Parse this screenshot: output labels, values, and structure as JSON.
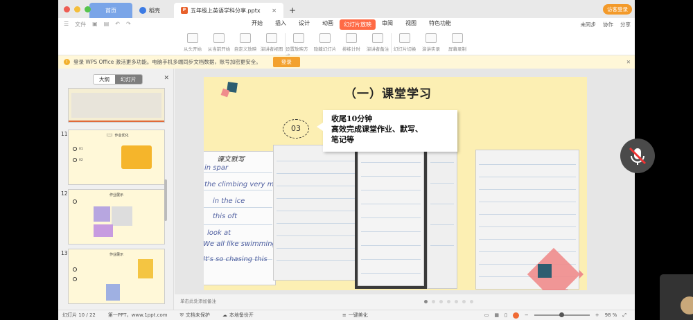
{
  "window": {
    "tabs": [
      {
        "label": "首页"
      },
      {
        "label": "稻壳"
      },
      {
        "label": "五年级上英语学科分享.pptx"
      }
    ],
    "login_button": "访客登录"
  },
  "menu": {
    "quick": [
      "文件"
    ],
    "items": [
      "开始",
      "插入",
      "设计",
      "动画",
      "幻灯片放映",
      "审阅",
      "视图",
      "特色功能"
    ],
    "active": "幻灯片放映",
    "right": [
      "未同步",
      "协作",
      "分享"
    ]
  },
  "ribbon": {
    "buttons": [
      "从头开始",
      "从当前开始",
      "自定义放映",
      "演讲者视图",
      "设置放映方式",
      "隐藏幻灯片",
      "排练计时",
      "演讲者备注",
      "幻灯片切换",
      "演讲实录",
      "屏幕录制"
    ]
  },
  "notice": {
    "text": "登录 WPS Office 激活更多功能。电脑手机多端同步文档数据，账号加密更安全。",
    "button": "登录"
  },
  "panel": {
    "tabs": [
      "大纲",
      "幻灯片"
    ],
    "active_tab": "幻灯片",
    "thumbnails": [
      {
        "number": "11",
        "title": "（二）作业优化"
      },
      {
        "number": "12",
        "title": "作业展示"
      },
      {
        "number": "13",
        "title": "作业展示"
      }
    ]
  },
  "slide": {
    "heading": "（一）课堂学习",
    "step_number": "03",
    "callout_lines": [
      "收尾10分钟",
      "高效完成课堂作业、默写、",
      "笔记等"
    ],
    "handwriting": [
      "课文默写",
      "in spar",
      "the climbing very much",
      "in the ice",
      "this oft",
      "look at",
      "We all like swimming",
      "It's so chasing this"
    ]
  },
  "notes_placeholder": "单击此处添加备注",
  "status": {
    "slide_indicator": "幻灯片 10 / 22",
    "theme": "第一PPT，www.1ppt.com",
    "protect": "文档未保护",
    "backup": "本地备份开",
    "beautify": "一键美化",
    "zoom": "98 %"
  },
  "colors": {
    "accent": "#ff6a45",
    "slide_bg": "#fcefb3",
    "teal": "#2d5d70",
    "pink": "#ef8c8c"
  }
}
